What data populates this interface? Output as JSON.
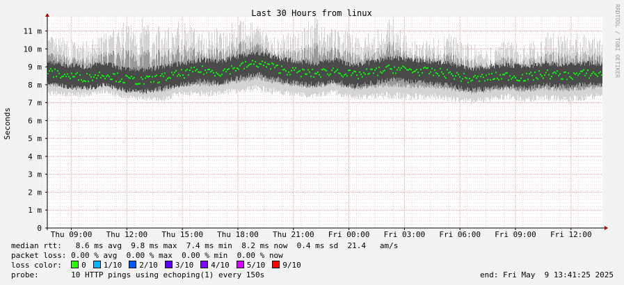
{
  "chart_data": {
    "type": "area",
    "title": "Last 30 Hours from linux",
    "ylabel": "Seconds",
    "xlabel": "",
    "y_unit": "ms",
    "ylim": [
      0,
      11.8
    ],
    "yticks": [
      0,
      1,
      2,
      3,
      4,
      5,
      6,
      7,
      8,
      9,
      10,
      11
    ],
    "ytick_labels": [
      "0",
      "1 m",
      "2 m",
      "3 m",
      "4 m",
      "5 m",
      "6 m",
      "7 m",
      "8 m",
      "9 m",
      "10 m",
      "11 m"
    ],
    "xticks": [
      "Thu 09:00",
      "Thu 12:00",
      "Thu 15:00",
      "Thu 18:00",
      "Thu 21:00",
      "Fri 00:00",
      "Fri 03:00",
      "Fri 06:00",
      "Fri 09:00",
      "Fri 12:00"
    ],
    "xrange_hours": [
      -30,
      0
    ],
    "xtick_hours_ago": [
      28.7,
      25.7,
      22.7,
      19.7,
      16.7,
      13.7,
      10.7,
      7.7,
      4.7,
      1.7
    ],
    "grid": true,
    "series": [
      {
        "name": "median rtt",
        "color": "#00ff00",
        "median_ms_by_hour": [
          8.7,
          8.5,
          8.4,
          8.6,
          8.3,
          8.2,
          8.4,
          8.6,
          8.8,
          8.7,
          9.0,
          9.2,
          8.9,
          8.7,
          8.6,
          8.8,
          8.5,
          8.7,
          8.9,
          8.8,
          8.7,
          8.6,
          8.3,
          8.4,
          8.5,
          8.4,
          8.6,
          8.5,
          8.6,
          8.6
        ],
        "spread_min_ms_by_hour": [
          7.4,
          7.3,
          7.3,
          7.5,
          7.2,
          7.1,
          7.0,
          7.4,
          7.3,
          7.4,
          7.5,
          7.6,
          7.4,
          7.3,
          7.2,
          7.4,
          7.1,
          7.2,
          7.2,
          7.1,
          7.2,
          7.0,
          6.9,
          7.0,
          7.2,
          7.0,
          7.1,
          7.0,
          7.1,
          7.2
        ],
        "spread_max_ms_by_hour": [
          10.8,
          10.6,
          10.4,
          10.9,
          11.5,
          11.8,
          11.2,
          11.8,
          10.9,
          11.3,
          11.6,
          11.4,
          10.6,
          11.2,
          11.8,
          11.3,
          10.8,
          11.0,
          11.8,
          10.4,
          10.6,
          10.9,
          10.3,
          10.2,
          10.5,
          10.2,
          11.0,
          10.8,
          10.9,
          10.6
        ]
      }
    ]
  },
  "legend": {
    "median_label": "median rtt:",
    "median_avg": "8.6 ms avg",
    "median_max": "9.8 ms max",
    "median_min": "7.4 ms min",
    "median_now": "8.2 ms now",
    "median_sd": "0.4 ms sd",
    "median_ams": "21.4   am/s",
    "loss_label": "packet loss:",
    "loss_avg": "0.00 % avg",
    "loss_max": "0.00 % max",
    "loss_min": "0.00 % min",
    "loss_now": "0.00 % now",
    "loss_color_label": "loss color:",
    "loss_colors": [
      {
        "label": "0",
        "color": "#26ff00"
      },
      {
        "label": "1/10",
        "color": "#00b8ff"
      },
      {
        "label": "2/10",
        "color": "#0059ff"
      },
      {
        "label": "3/10",
        "color": "#5e00ff"
      },
      {
        "label": "4/10",
        "color": "#7e00ff"
      },
      {
        "label": "5/10",
        "color": "#dd00ff"
      },
      {
        "label": "9/10",
        "color": "#ff0000"
      }
    ],
    "probe_label": "probe:",
    "probe_desc": "10 HTTP pings using echoping(1) every 150s",
    "end_label": "end: Fri May  9 13:41:25 2025"
  },
  "watermark": "RRDTOOL / TOBI OETIKER"
}
